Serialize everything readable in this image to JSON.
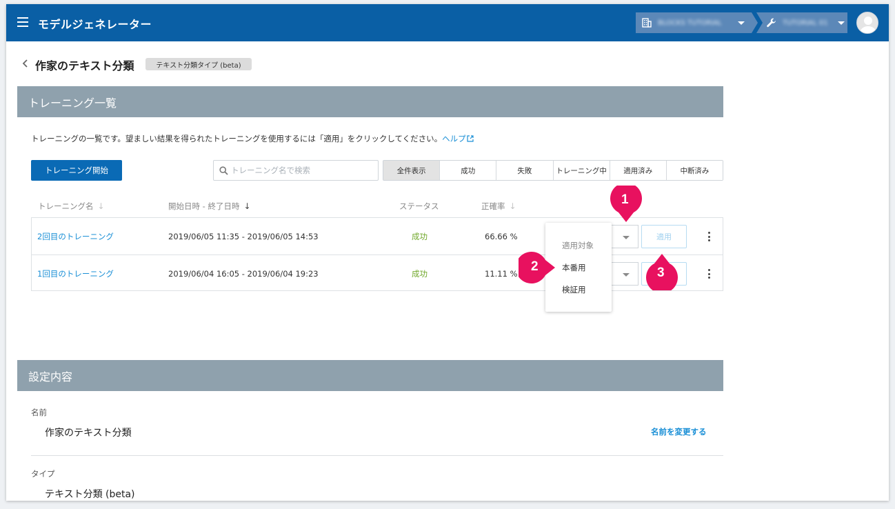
{
  "app": {
    "title": "モデルジェネレーター"
  },
  "breadcrumb": {
    "organization": "BLOCKS TUTORIAL",
    "project": "TUTORIAL 01"
  },
  "page": {
    "title": "作家のテキスト分類",
    "type_badge": "テキスト分類タイプ (beta)"
  },
  "training": {
    "header": "トレーニング一覧",
    "description": "トレーニングの一覧です。望ましい結果を得られたトレーニングを使用するには「適用」をクリックしてください。",
    "help_link": "ヘルプ",
    "start_button": "トレーニング開始",
    "search_placeholder": "トレーニング名で検索",
    "filters": [
      "全件表示",
      "成功",
      "失敗",
      "トレーニング中",
      "適用済み",
      "中断済み"
    ],
    "columns": {
      "name": "トレーニング名",
      "period": "開始日時 - 終了日時",
      "status": "ステータス",
      "accuracy": "正確率"
    },
    "rows": [
      {
        "name": "2回目のトレーニング",
        "period": "2019/06/05 11:35 - 2019/06/05 14:53",
        "status": "成功",
        "accuracy": "66.66 %",
        "apply_label": "適用"
      },
      {
        "name": "1回目のトレーニング",
        "period": "2019/06/04 16:05 - 2019/06/04 19:23",
        "status": "成功",
        "accuracy": "11.11 %",
        "apply_label": "適用"
      }
    ],
    "dropdown": {
      "header": "適用対象",
      "options": [
        "本番用",
        "検証用"
      ]
    }
  },
  "callouts": [
    "1",
    "2",
    "3"
  ],
  "settings": {
    "header": "設定内容",
    "name_label": "名前",
    "name_value": "作家のテキスト分類",
    "rename_link": "名前を変更する",
    "type_label": "タイプ",
    "type_value": "テキスト分類 (beta)"
  },
  "colors": {
    "appbar": "#0a5fa5",
    "section_header": "#8fa1ad",
    "primary": "#0a6ab5",
    "link": "#1a8fd6",
    "success": "#71a82b",
    "callout": "#e8115f"
  }
}
